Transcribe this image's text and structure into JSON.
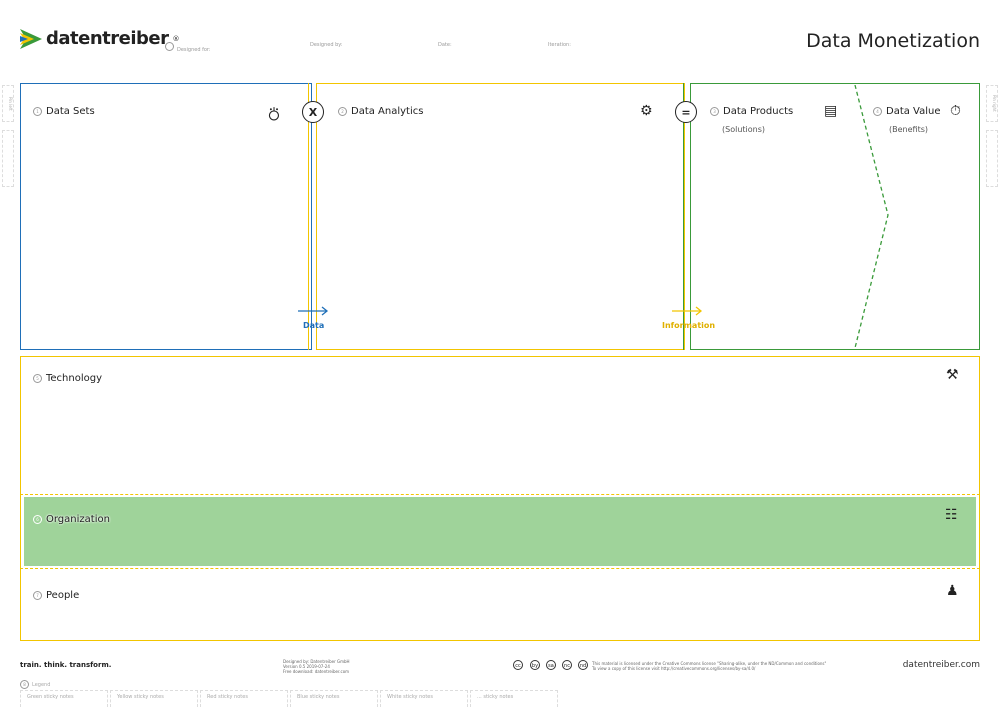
{
  "header": {
    "logo_text": "datentreiber",
    "logo_reg": "®",
    "meta": [
      "Designed for:",
      "Designed by:",
      "Date:",
      "Iteration:"
    ],
    "title": "Data Monetization"
  },
  "canvas": {
    "data_sets": {
      "num": "1",
      "label": "Data Sets"
    },
    "data_analytics": {
      "num": "2",
      "label": "Data Analytics"
    },
    "data_products": {
      "num": "3",
      "label": "Data Products",
      "sub": "(Solutions)"
    },
    "data_value": {
      "num": "4",
      "label": "Data Value",
      "sub": "(Benefits)"
    },
    "op_multiply": "X",
    "op_equals": "=",
    "flow_data": "Data",
    "flow_information": "Information",
    "technology": {
      "num": "5",
      "label": "Technology"
    },
    "organization": {
      "num": "6",
      "label": "Organization"
    },
    "people": {
      "num": "7",
      "label": "People"
    }
  },
  "side_tabs": {
    "left": "Pin left",
    "right": "Pin right"
  },
  "footer": {
    "tagline": "train. think. transform.",
    "credits": [
      "Designed by: Datentreiber GmbH",
      "Version 0.5 2019-07-24",
      "Free download: datentreiber.com"
    ],
    "cc_icons": [
      "cc",
      "by",
      "sa",
      "nc",
      "nd"
    ],
    "license": [
      "This material is licensed under the Creative Commons license \"Sharing-alike, under the ND/Common and conditions\"",
      "To view a copy of this license visit http://creativecommons.org/licenses/by-sa/4.0/"
    ],
    "site": "datentreiber.com",
    "legend_num": "8",
    "legend": "Legend",
    "stickies": [
      "Green sticky notes",
      "Yellow sticky notes",
      "Red sticky notes",
      "Blue sticky notes",
      "White sticky notes",
      "... sticky notes"
    ]
  },
  "colors": {
    "blue": "#1f6fb8",
    "yellow": "#f2c500",
    "green": "#3a9a3a",
    "org_fill": "#9fd39a"
  }
}
